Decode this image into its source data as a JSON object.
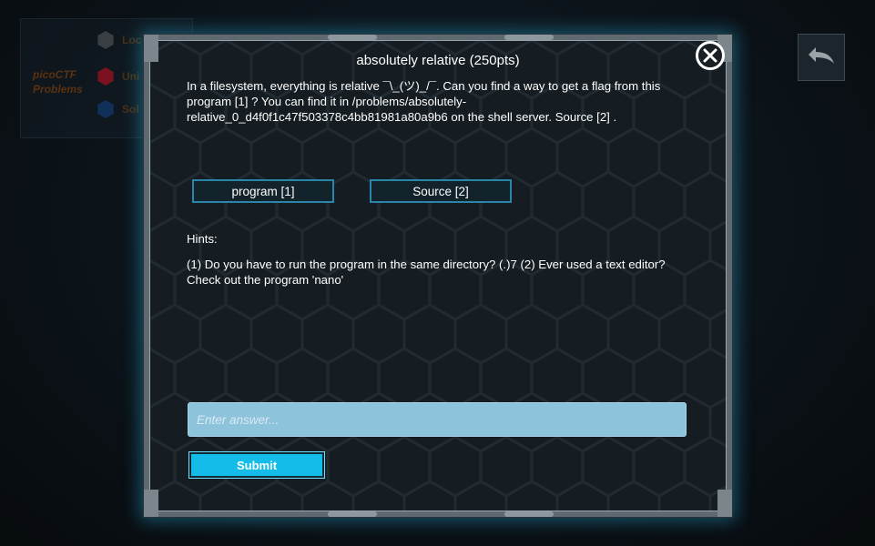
{
  "background": {
    "panel_title": "picoCTF Problems",
    "menu_items": [
      {
        "label": "Loc",
        "color": "#3a3f44"
      },
      {
        "label": "Uni",
        "color": "#7a1020"
      },
      {
        "label": "Sol",
        "color": "#10305a"
      }
    ],
    "back_icon": "back-arrow-icon"
  },
  "modal": {
    "title": "absolutely relative (250pts)",
    "description": "In a filesystem, everything is relative ¯\\_(ツ)_/¯. Can you find a way to get a flag from this program [1] ? You can find it in /problems/absolutely-relative_0_d4f0f1c47f503378c4bb81981a80a9b6 on the shell server. Source [2] .",
    "links": [
      {
        "label": "program [1]"
      },
      {
        "label": "Source [2]"
      }
    ],
    "hints_label": "Hints:",
    "hints_text": "(1) Do you have to run the program in the same directory? (.)7 (2) Ever used a text editor? Check out the program 'nano'",
    "answer_placeholder": "Enter answer...",
    "submit_label": "Submit",
    "close_icon": "close-icon",
    "accent_color": "#14bde9"
  }
}
